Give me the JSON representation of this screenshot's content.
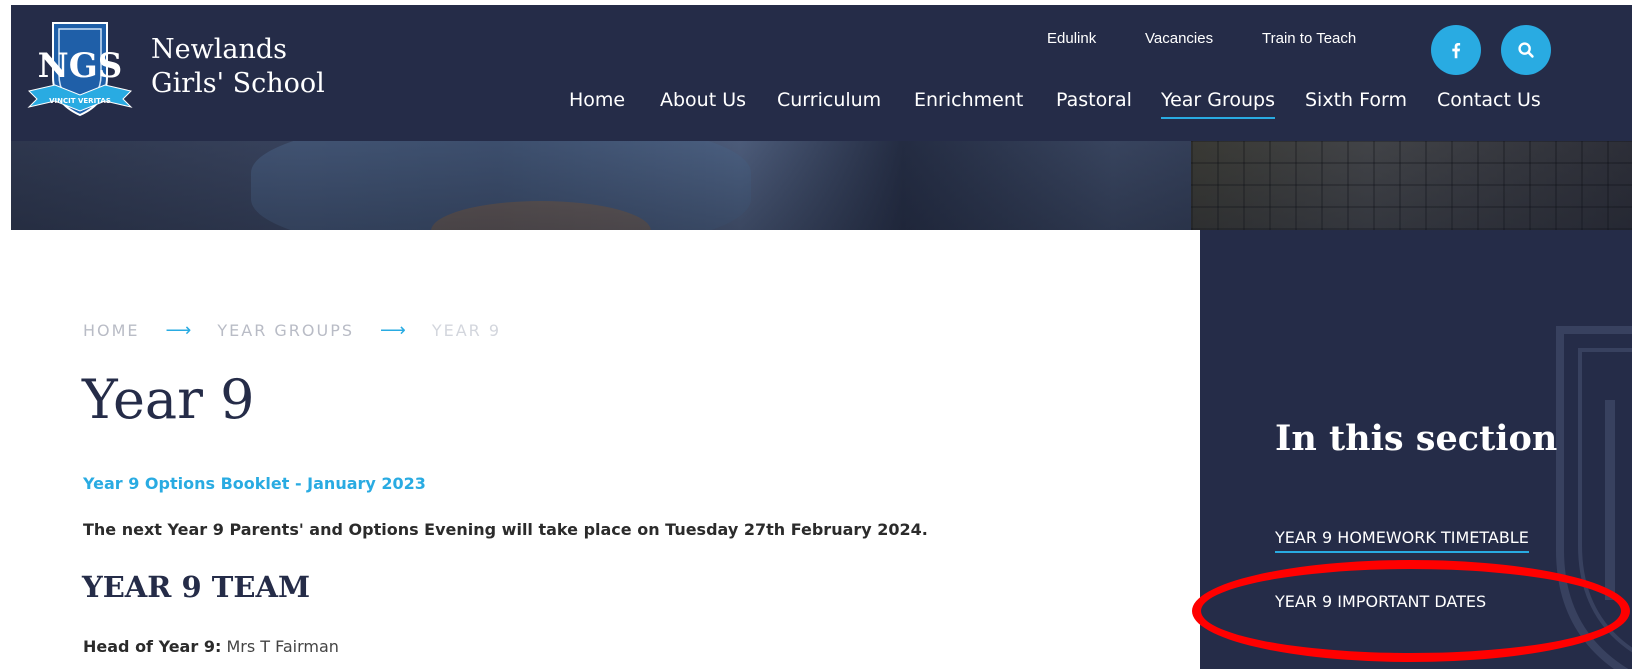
{
  "header": {
    "logo": {
      "monogram": "NGS",
      "motto": "VINCIT VERITAS",
      "line1": "Newlands",
      "line2": "Girls' School"
    },
    "utility_links": [
      "Edulink",
      "Vacancies",
      "Train to Teach"
    ],
    "social": {
      "facebook_icon": "facebook-icon",
      "search_icon": "search-icon"
    },
    "main_nav": [
      "Home",
      "About Us",
      "Curriculum",
      "Enrichment",
      "Pastoral",
      "Year Groups",
      "Sixth Form",
      "Contact Us"
    ],
    "active_nav": "Year Groups"
  },
  "breadcrumb": [
    "HOME",
    "YEAR GROUPS",
    "YEAR 9"
  ],
  "breadcrumb_separator": "⟶",
  "main": {
    "title": "Year 9",
    "options_link": "Year 9 Options Booklet - January 2023",
    "evening_text": "The next Year 9 Parents' and Options Evening will take place on Tuesday 27th February 2024.",
    "team_heading": "YEAR 9 TEAM",
    "head_label": "Head of Year 9:",
    "head_name": "Mrs T Fairman"
  },
  "sidebar": {
    "heading": "In this section",
    "links": [
      "YEAR 9 HOMEWORK TIMETABLE",
      "YEAR 9 IMPORTANT DATES"
    ]
  },
  "colors": {
    "navy": "#252c48",
    "accent": "#29abe2",
    "highlight": "#ff0000"
  }
}
